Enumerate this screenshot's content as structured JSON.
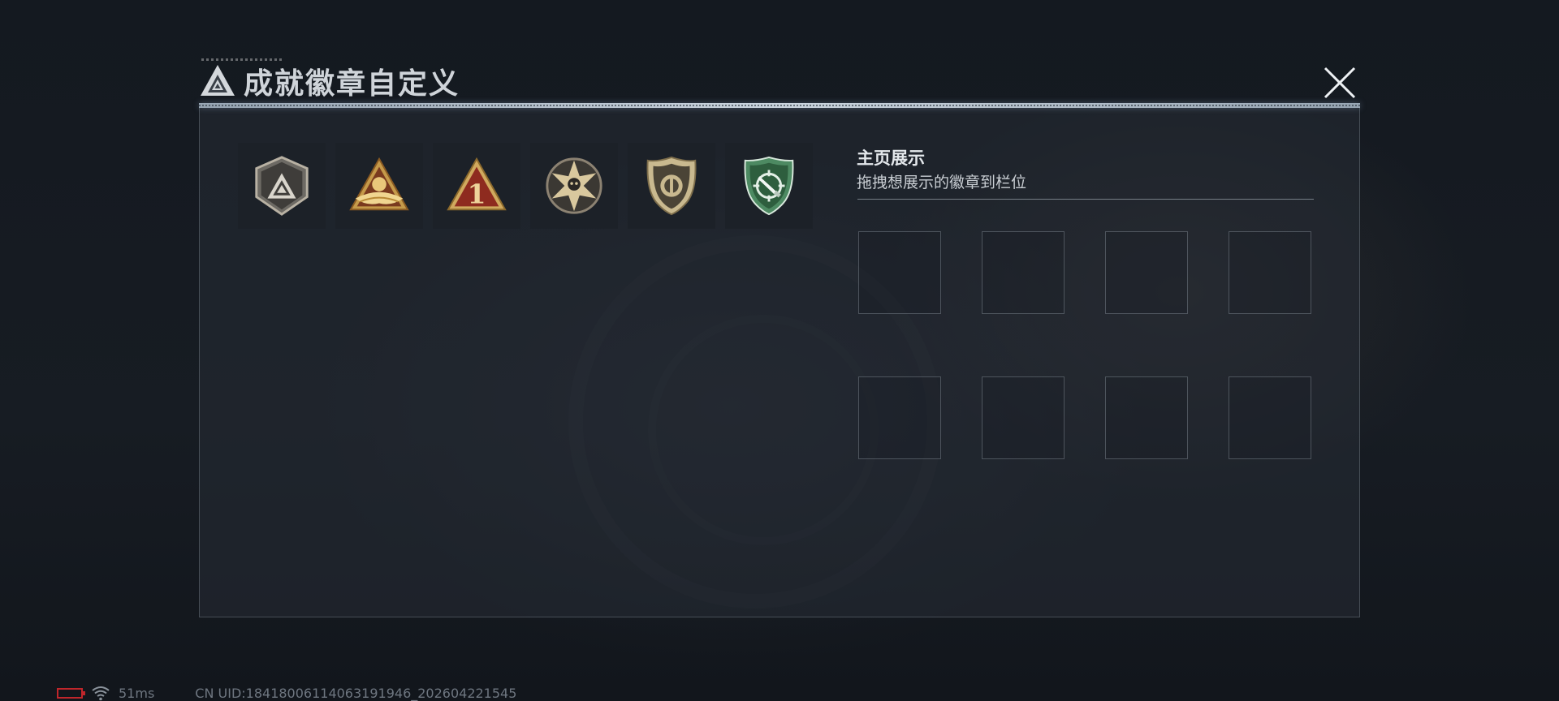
{
  "dialog": {
    "title": "成就徽章自定义",
    "close_icon": "close-icon"
  },
  "badges": [
    {
      "name": "shield-triangle-badge",
      "icon": "shield-triangle-icon"
    },
    {
      "name": "wings-triangle-badge",
      "icon": "wings-triangle-icon"
    },
    {
      "name": "number-one-badge",
      "icon": "number-one-triangle-icon",
      "text": "1"
    },
    {
      "name": "skull-star-badge",
      "icon": "skull-star-icon"
    },
    {
      "name": "police-shield-badge",
      "icon": "police-shield-icon"
    },
    {
      "name": "knife-crosshair-badge",
      "icon": "knife-crosshair-icon"
    }
  ],
  "showcase": {
    "title": "主页展示",
    "hint": "拖拽想展示的徽章到栏位",
    "slot_count": 8
  },
  "status": {
    "ping": "51ms",
    "uid": "CN UID:18418006114063191946_202604221545",
    "battery_color": "#c0262b"
  }
}
